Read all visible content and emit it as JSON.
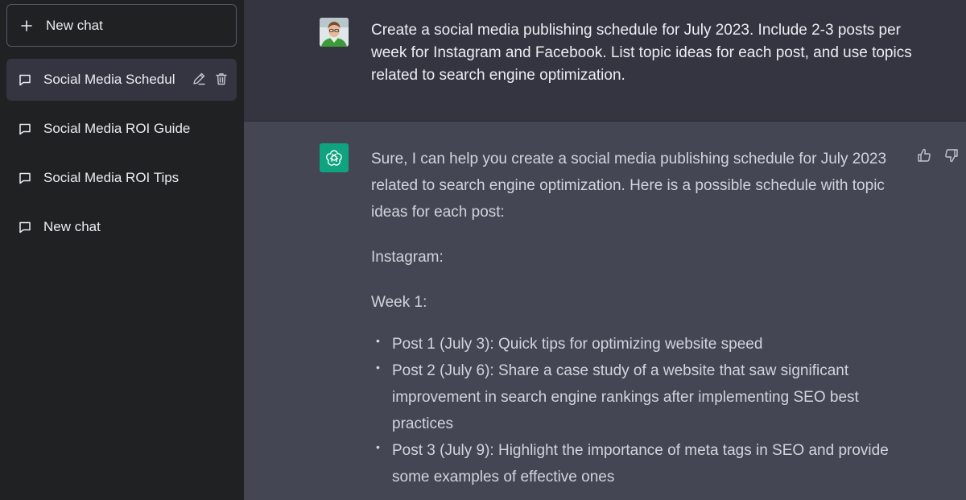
{
  "sidebar": {
    "new_chat_label": "New chat",
    "chats": [
      {
        "title": "Social Media Schedul",
        "active": true
      },
      {
        "title": "Social Media ROI Guide",
        "active": false
      },
      {
        "title": "Social Media ROI Tips",
        "active": false
      },
      {
        "title": "New chat",
        "active": false
      }
    ]
  },
  "conversation": {
    "user_message": "Create a social media publishing schedule for July 2023. Include 2-3 posts per week for Instagram and Facebook. List topic ideas for each post, and use topics related to search engine optimization.",
    "assistant": {
      "intro": "Sure, I can help you create a social media publishing schedule for July 2023 related to search engine optimization. Here is a possible schedule with topic ideas for each post:",
      "platform": "Instagram:",
      "week": "Week 1:",
      "posts": [
        "Post 1 (July 3): Quick tips for optimizing website speed",
        "Post 2 (July 6): Share a case study of a website that saw significant improvement in search engine rankings after implementing SEO best practices",
        "Post 3 (July 9): Highlight the importance of meta tags in SEO and provide some examples of effective ones"
      ]
    }
  },
  "icons": {
    "plus": "plus-icon",
    "message": "message-icon",
    "edit": "pencil-icon",
    "delete": "trash-icon",
    "thumbs_up": "thumbs-up-icon",
    "thumbs_down": "thumbs-down-icon",
    "bot_logo": "openai-logo-icon"
  },
  "colors": {
    "sidebar_bg": "#202123",
    "user_row_bg": "#343541",
    "assistant_row_bg": "#444654",
    "bot_avatar_bg": "#10a37f"
  }
}
